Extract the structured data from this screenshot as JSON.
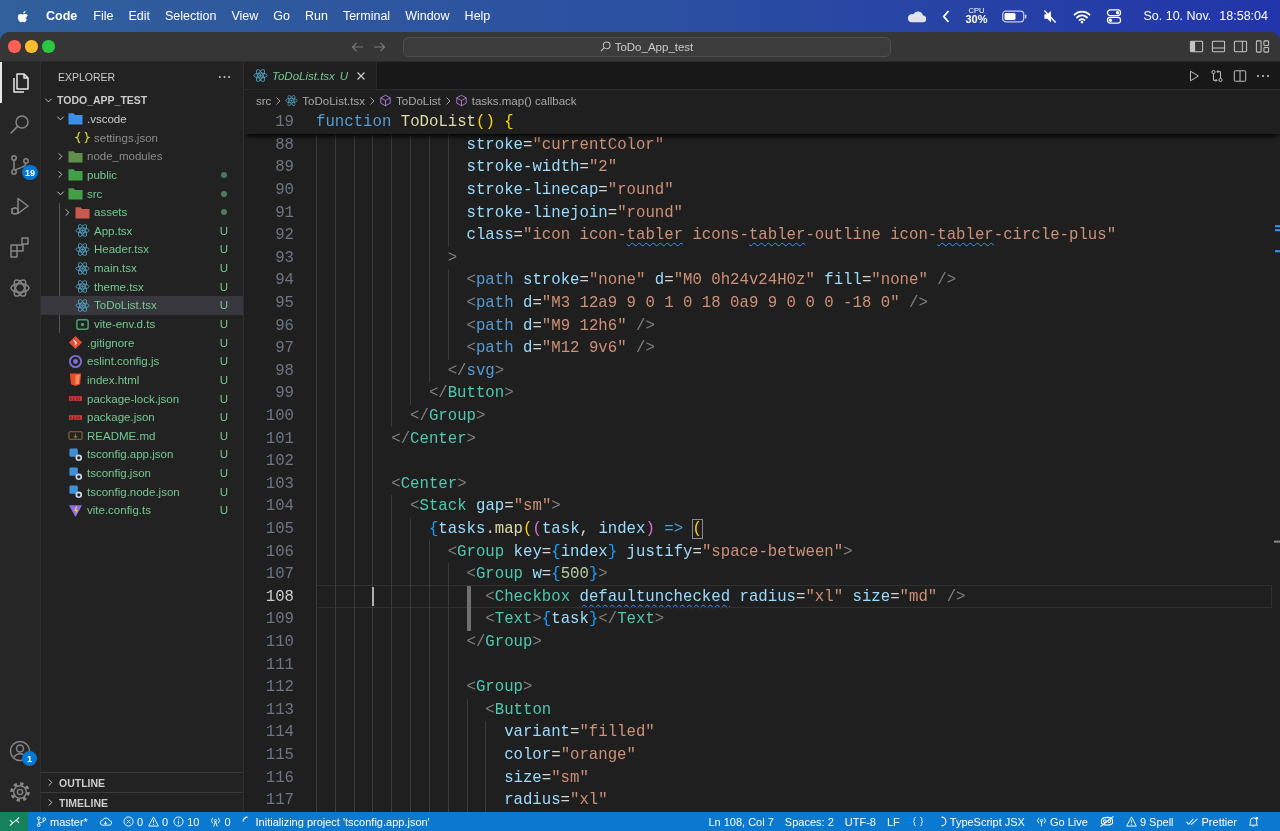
{
  "menu_bar": {
    "app_name": "Code",
    "menus": [
      "File",
      "Edit",
      "Selection",
      "View",
      "Go",
      "Run",
      "Terminal",
      "Window",
      "Help"
    ],
    "cpu_label": "CPU",
    "cpu_value": "30%",
    "date": "So. 10. Nov.",
    "time": "18:58:04"
  },
  "title_bar": {
    "command_center": "ToDo_App_test"
  },
  "activity_bar": {
    "items": [
      {
        "selected": true
      },
      {
        "selected": false
      },
      {
        "selected": false,
        "badge": "19"
      },
      {
        "selected": false
      },
      {
        "selected": false
      },
      {
        "selected": false
      }
    ],
    "accounts_badge": "1"
  },
  "explorer": {
    "title": "EXPLORER",
    "root": {
      "label": "TODO_APP_TEST",
      "expanded": true,
      "children": [
        {
          "label": ".vscode",
          "kind": "folder",
          "color": "#3b8eea",
          "expanded": true,
          "selected": false,
          "ignored": false,
          "changed": false,
          "children": [
            {
              "label": "settings.json",
              "kind": "json",
              "selected": false,
              "ignored": true,
              "changed": false
            }
          ]
        },
        {
          "label": "node_modules",
          "kind": "folder",
          "color": "#5f8f4a",
          "expanded": false,
          "selected": false,
          "ignored": true,
          "changed": false
        },
        {
          "label": "public",
          "kind": "folder",
          "color": "#43a047",
          "expanded": false,
          "selected": false,
          "ignored": false,
          "changed": true
        },
        {
          "label": "src",
          "kind": "folder",
          "color": "#43a047",
          "expanded": true,
          "selected": false,
          "ignored": false,
          "changed": true,
          "children": [
            {
              "label": "assets",
              "kind": "folder",
              "color": "#c65a4d",
              "expanded": false,
              "selected": false,
              "ignored": false,
              "changed": true
            },
            {
              "label": "App.tsx",
              "kind": "react",
              "decoration": "U",
              "selected": false,
              "ignored": false,
              "changed": false
            },
            {
              "label": "Header.tsx",
              "kind": "react",
              "decoration": "U",
              "selected": false,
              "ignored": false,
              "changed": false
            },
            {
              "label": "main.tsx",
              "kind": "react",
              "decoration": "U",
              "selected": false,
              "ignored": false,
              "changed": false
            },
            {
              "label": "theme.tsx",
              "kind": "react",
              "decoration": "U",
              "selected": false,
              "ignored": false,
              "changed": false
            },
            {
              "label": "ToDoList.tsx",
              "kind": "react",
              "decoration": "U",
              "selected": true,
              "ignored": false,
              "changed": false
            },
            {
              "label": "vite-env.d.ts",
              "kind": "ts",
              "decoration": "U",
              "selected": false,
              "ignored": false,
              "changed": false
            }
          ]
        },
        {
          "label": ".gitignore",
          "kind": "git",
          "decoration": "U",
          "selected": false,
          "ignored": false,
          "changed": false
        },
        {
          "label": "eslint.config.js",
          "kind": "eslint",
          "decoration": "U",
          "selected": false,
          "ignored": false,
          "changed": false
        },
        {
          "label": "index.html",
          "kind": "html",
          "decoration": "U",
          "selected": false,
          "ignored": false,
          "changed": false
        },
        {
          "label": "package-lock.json",
          "kind": "npm",
          "decoration": "U",
          "selected": false,
          "ignored": false,
          "changed": false
        },
        {
          "label": "package.json",
          "kind": "npm",
          "decoration": "U",
          "selected": false,
          "ignored": false,
          "changed": false
        },
        {
          "label": "README.md",
          "kind": "markdown",
          "decoration": "U",
          "selected": false,
          "ignored": false,
          "changed": false
        },
        {
          "label": "tsconfig.app.json",
          "kind": "tsconfig",
          "decoration": "U",
          "selected": false,
          "ignored": false,
          "changed": false
        },
        {
          "label": "tsconfig.json",
          "kind": "tsconfig",
          "decoration": "U",
          "selected": false,
          "ignored": false,
          "changed": false
        },
        {
          "label": "tsconfig.node.json",
          "kind": "tsconfig",
          "decoration": "U",
          "selected": false,
          "ignored": false,
          "changed": false
        },
        {
          "label": "vite.config.ts",
          "kind": "vite",
          "decoration": "U",
          "selected": false,
          "ignored": false,
          "changed": false
        }
      ]
    },
    "sections": [
      {
        "label": "OUTLINE",
        "expanded": false
      },
      {
        "label": "TIMELINE",
        "expanded": false
      }
    ]
  },
  "editor": {
    "tabs": [
      {
        "label": "ToDoList.tsx",
        "decoration": "U",
        "selected": true,
        "preview": true
      }
    ],
    "breadcrumbs": [
      {
        "label": "src",
        "kind": "folder"
      },
      {
        "label": "ToDoList.tsx",
        "kind": "react"
      },
      {
        "label": "ToDoList",
        "kind": "symbol"
      },
      {
        "label": "tasks.map() callback",
        "kind": "symbol"
      }
    ],
    "sticky_line": {
      "number": "19",
      "tokens": [
        {
          "kind": "keyword",
          "text": "function"
        },
        {
          "kind": "function",
          "text": " ToDoList"
        },
        {
          "kind": "bracket",
          "text": "()"
        },
        {
          "kind": "bracket",
          "text": " {"
        }
      ]
    },
    "lines": [
      {
        "number": "88",
        "current": false,
        "indent": [
          {
            "kind": "guide"
          },
          {
            "kind": "guide"
          },
          {
            "kind": "guide"
          },
          {
            "kind": "guide"
          },
          {
            "kind": "guide"
          },
          {
            "kind": "guide"
          },
          {
            "kind": "guide"
          },
          {
            "kind": "guide"
          }
        ],
        "tokens": [
          {
            "kind": "attr",
            "text": "stroke"
          },
          {
            "kind": "op",
            "text": "="
          },
          {
            "kind": "string",
            "text": "\"currentColor\""
          }
        ]
      },
      {
        "number": "89",
        "current": false,
        "indent": [
          {
            "kind": "guide"
          },
          {
            "kind": "guide"
          },
          {
            "kind": "guide"
          },
          {
            "kind": "guide"
          },
          {
            "kind": "guide"
          },
          {
            "kind": "guide"
          },
          {
            "kind": "guide"
          },
          {
            "kind": "guide"
          }
        ],
        "tokens": [
          {
            "kind": "attr",
            "text": "stroke-width"
          },
          {
            "kind": "op",
            "text": "="
          },
          {
            "kind": "string",
            "text": "\"2\""
          }
        ]
      },
      {
        "number": "90",
        "current": false,
        "indent": [
          {
            "kind": "guide"
          },
          {
            "kind": "guide"
          },
          {
            "kind": "guide"
          },
          {
            "kind": "guide"
          },
          {
            "kind": "guide"
          },
          {
            "kind": "guide"
          },
          {
            "kind": "guide"
          },
          {
            "kind": "guide"
          }
        ],
        "tokens": [
          {
            "kind": "attr",
            "text": "stroke-linecap"
          },
          {
            "kind": "op",
            "text": "="
          },
          {
            "kind": "string",
            "text": "\"round\""
          }
        ]
      },
      {
        "number": "91",
        "current": false,
        "indent": [
          {
            "kind": "guide"
          },
          {
            "kind": "guide"
          },
          {
            "kind": "guide"
          },
          {
            "kind": "guide"
          },
          {
            "kind": "guide"
          },
          {
            "kind": "guide"
          },
          {
            "kind": "guide"
          },
          {
            "kind": "guide"
          }
        ],
        "tokens": [
          {
            "kind": "attr",
            "text": "stroke-linejoin"
          },
          {
            "kind": "op",
            "text": "="
          },
          {
            "kind": "string",
            "text": "\"round\""
          }
        ]
      },
      {
        "number": "92",
        "current": false,
        "indent": [
          {
            "kind": "guide"
          },
          {
            "kind": "guide"
          },
          {
            "kind": "guide"
          },
          {
            "kind": "guide"
          },
          {
            "kind": "guide"
          },
          {
            "kind": "guide"
          },
          {
            "kind": "guide"
          },
          {
            "kind": "guide"
          }
        ],
        "tokens": [
          {
            "kind": "attr",
            "text": "class"
          },
          {
            "kind": "op",
            "text": "="
          },
          {
            "kind": "string",
            "text": "\"icon icon-"
          },
          {
            "kind": "flaggedstring",
            "text": "tabler"
          },
          {
            "kind": "string",
            "text": " icons-"
          },
          {
            "kind": "flaggedstring",
            "text": "tabler"
          },
          {
            "kind": "string",
            "text": "-outline icon-"
          },
          {
            "kind": "flaggedstring",
            "text": "tabler"
          },
          {
            "kind": "string",
            "text": "-circle-plus\""
          }
        ]
      },
      {
        "number": "93",
        "current": false,
        "indent": [
          {
            "kind": "guide"
          },
          {
            "kind": "guide"
          },
          {
            "kind": "guide"
          },
          {
            "kind": "guide"
          },
          {
            "kind": "guide"
          },
          {
            "kind": "guide"
          },
          {
            "kind": "guide"
          }
        ],
        "tokens": [
          {
            "kind": "punct",
            "text": ">"
          }
        ]
      },
      {
        "number": "94",
        "current": false,
        "indent": [
          {
            "kind": "guide"
          },
          {
            "kind": "guide"
          },
          {
            "kind": "guide"
          },
          {
            "kind": "guide"
          },
          {
            "kind": "guide"
          },
          {
            "kind": "guide"
          },
          {
            "kind": "guide"
          },
          {
            "kind": "guide"
          }
        ],
        "tokens": [
          {
            "kind": "punct",
            "text": "<"
          },
          {
            "kind": "htmltag",
            "text": "path"
          },
          {
            "kind": "attr",
            "text": " stroke"
          },
          {
            "kind": "op",
            "text": "="
          },
          {
            "kind": "string",
            "text": "\"none\""
          },
          {
            "kind": "attr",
            "text": " d"
          },
          {
            "kind": "op",
            "text": "="
          },
          {
            "kind": "string",
            "text": "\"M0 0h24v24H0z\""
          },
          {
            "kind": "attr",
            "text": " fill"
          },
          {
            "kind": "op",
            "text": "="
          },
          {
            "kind": "string",
            "text": "\"none\""
          },
          {
            "kind": "punct",
            "text": " />"
          }
        ]
      },
      {
        "number": "95",
        "current": false,
        "indent": [
          {
            "kind": "guide"
          },
          {
            "kind": "guide"
          },
          {
            "kind": "guide"
          },
          {
            "kind": "guide"
          },
          {
            "kind": "guide"
          },
          {
            "kind": "guide"
          },
          {
            "kind": "guide"
          },
          {
            "kind": "guide"
          }
        ],
        "tokens": [
          {
            "kind": "punct",
            "text": "<"
          },
          {
            "kind": "htmltag",
            "text": "path"
          },
          {
            "kind": "attr",
            "text": " d"
          },
          {
            "kind": "op",
            "text": "="
          },
          {
            "kind": "string",
            "text": "\"M3 12a9 9 0 1 0 18 0a9 9 0 0 0 -18 0\""
          },
          {
            "kind": "punct",
            "text": " />"
          }
        ]
      },
      {
        "number": "96",
        "current": false,
        "indent": [
          {
            "kind": "guide"
          },
          {
            "kind": "guide"
          },
          {
            "kind": "guide"
          },
          {
            "kind": "guide"
          },
          {
            "kind": "guide"
          },
          {
            "kind": "guide"
          },
          {
            "kind": "guide"
          },
          {
            "kind": "guide"
          }
        ],
        "tokens": [
          {
            "kind": "punct",
            "text": "<"
          },
          {
            "kind": "htmltag",
            "text": "path"
          },
          {
            "kind": "attr",
            "text": " d"
          },
          {
            "kind": "op",
            "text": "="
          },
          {
            "kind": "string",
            "text": "\"M9 12h6\""
          },
          {
            "kind": "punct",
            "text": " />"
          }
        ]
      },
      {
        "number": "97",
        "current": false,
        "indent": [
          {
            "kind": "guide"
          },
          {
            "kind": "guide"
          },
          {
            "kind": "guide"
          },
          {
            "kind": "guide"
          },
          {
            "kind": "guide"
          },
          {
            "kind": "guide"
          },
          {
            "kind": "guide"
          },
          {
            "kind": "guide"
          }
        ],
        "tokens": [
          {
            "kind": "punct",
            "text": "<"
          },
          {
            "kind": "htmltag",
            "text": "path"
          },
          {
            "kind": "attr",
            "text": " d"
          },
          {
            "kind": "op",
            "text": "="
          },
          {
            "kind": "string",
            "text": "\"M12 9v6\""
          },
          {
            "kind": "punct",
            "text": " />"
          }
        ]
      },
      {
        "number": "98",
        "current": false,
        "indent": [
          {
            "kind": "guide"
          },
          {
            "kind": "guide"
          },
          {
            "kind": "guide"
          },
          {
            "kind": "guide"
          },
          {
            "kind": "guide"
          },
          {
            "kind": "guide"
          },
          {
            "kind": "guide"
          }
        ],
        "tokens": [
          {
            "kind": "punct",
            "text": "</"
          },
          {
            "kind": "htmltag",
            "text": "svg"
          },
          {
            "kind": "punct",
            "text": ">"
          }
        ]
      },
      {
        "number": "99",
        "current": false,
        "indent": [
          {
            "kind": "guide"
          },
          {
            "kind": "guide"
          },
          {
            "kind": "guide"
          },
          {
            "kind": "guide"
          },
          {
            "kind": "guide"
          },
          {
            "kind": "guide"
          }
        ],
        "tokens": [
          {
            "kind": "punct",
            "text": "</"
          },
          {
            "kind": "tag",
            "text": "Button"
          },
          {
            "kind": "punct",
            "text": ">"
          }
        ]
      },
      {
        "number": "100",
        "current": false,
        "indent": [
          {
            "kind": "guide"
          },
          {
            "kind": "guide"
          },
          {
            "kind": "guide"
          },
          {
            "kind": "guide"
          },
          {
            "kind": "guide"
          }
        ],
        "tokens": [
          {
            "kind": "punct",
            "text": "</"
          },
          {
            "kind": "tag",
            "text": "Group"
          },
          {
            "kind": "punct",
            "text": ">"
          }
        ]
      },
      {
        "number": "101",
        "current": false,
        "indent": [
          {
            "kind": "guide"
          },
          {
            "kind": "guide"
          },
          {
            "kind": "guide"
          },
          {
            "kind": "guide"
          }
        ],
        "tokens": [
          {
            "kind": "punct",
            "text": "</"
          },
          {
            "kind": "tag",
            "text": "Center"
          },
          {
            "kind": "punct",
            "text": ">"
          }
        ]
      },
      {
        "number": "102",
        "current": false,
        "indent": [
          {
            "kind": "guide"
          },
          {
            "kind": "guide"
          },
          {
            "kind": "guide"
          },
          {
            "kind": "guide"
          }
        ]
      },
      {
        "number": "103",
        "current": false,
        "indent": [
          {
            "kind": "guide"
          },
          {
            "kind": "guide"
          },
          {
            "kind": "guide"
          },
          {
            "kind": "guide"
          }
        ],
        "tokens": [
          {
            "kind": "punct",
            "text": "<"
          },
          {
            "kind": "tag",
            "text": "Center"
          },
          {
            "kind": "punct",
            "text": ">"
          }
        ]
      },
      {
        "number": "104",
        "current": false,
        "indent": [
          {
            "kind": "guide"
          },
          {
            "kind": "guide"
          },
          {
            "kind": "guide"
          },
          {
            "kind": "guide"
          },
          {
            "kind": "guide"
          }
        ],
        "tokens": [
          {
            "kind": "punct",
            "text": "<"
          },
          {
            "kind": "tag",
            "text": "Stack"
          },
          {
            "kind": "attr",
            "text": " gap"
          },
          {
            "kind": "op",
            "text": "="
          },
          {
            "kind": "string",
            "text": "\"sm\""
          },
          {
            "kind": "punct",
            "text": ">"
          }
        ]
      },
      {
        "number": "105",
        "current": false,
        "indent": [
          {
            "kind": "guide"
          },
          {
            "kind": "guide"
          },
          {
            "kind": "guide"
          },
          {
            "kind": "guide"
          },
          {
            "kind": "guide"
          },
          {
            "kind": "guide"
          }
        ],
        "tokens": [
          {
            "kind": "bracketblue",
            "text": "{"
          },
          {
            "kind": "variable",
            "text": "tasks"
          },
          {
            "kind": "op",
            "text": "."
          },
          {
            "kind": "function",
            "text": "map"
          },
          {
            "kind": "bracket",
            "text": "("
          },
          {
            "kind": "bracketpink",
            "text": "("
          },
          {
            "kind": "variable",
            "text": "task"
          },
          {
            "kind": "op",
            "text": ", "
          },
          {
            "kind": "variable",
            "text": "index"
          },
          {
            "kind": "bracketpink",
            "text": ")"
          },
          {
            "kind": "keyword",
            "text": " => "
          },
          {
            "kind": "bracketmatch",
            "text": "("
          }
        ]
      },
      {
        "number": "106",
        "current": false,
        "indent": [
          {
            "kind": "guide"
          },
          {
            "kind": "guide"
          },
          {
            "kind": "guide"
          },
          {
            "kind": "guide"
          },
          {
            "kind": "guide"
          },
          {
            "kind": "guide"
          },
          {
            "kind": "guide"
          }
        ],
        "tokens": [
          {
            "kind": "punct",
            "text": "<"
          },
          {
            "kind": "tag",
            "text": "Group"
          },
          {
            "kind": "attr",
            "text": " key"
          },
          {
            "kind": "op",
            "text": "="
          },
          {
            "kind": "bracketblue",
            "text": "{"
          },
          {
            "kind": "variable",
            "text": "index"
          },
          {
            "kind": "bracketblue",
            "text": "}"
          },
          {
            "kind": "attr",
            "text": " justify"
          },
          {
            "kind": "op",
            "text": "="
          },
          {
            "kind": "string",
            "text": "\"space-between\""
          },
          {
            "kind": "punct",
            "text": ">"
          }
        ]
      },
      {
        "number": "107",
        "current": false,
        "indent": [
          {
            "kind": "guide"
          },
          {
            "kind": "guide"
          },
          {
            "kind": "guide"
          },
          {
            "kind": "guide"
          },
          {
            "kind": "guide"
          },
          {
            "kind": "guide"
          },
          {
            "kind": "guide"
          },
          {
            "kind": "guide"
          }
        ],
        "tokens": [
          {
            "kind": "punct",
            "text": "<"
          },
          {
            "kind": "tag",
            "text": "Group"
          },
          {
            "kind": "attr",
            "text": " w"
          },
          {
            "kind": "op",
            "text": "="
          },
          {
            "kind": "bracketblue",
            "text": "{"
          },
          {
            "kind": "number",
            "text": "500"
          },
          {
            "kind": "bracketblue",
            "text": "}"
          },
          {
            "kind": "punct",
            "text": ">"
          }
        ]
      },
      {
        "number": "108",
        "current": true,
        "indent": [
          {
            "kind": "guide"
          },
          {
            "kind": "guide"
          },
          {
            "kind": "guide"
          },
          {
            "kind": "cursor"
          },
          {
            "kind": "guide"
          },
          {
            "kind": "guide"
          },
          {
            "kind": "guide"
          },
          {
            "kind": "guide"
          },
          {
            "kind": "guide"
          },
          {
            "kind": "activeguide"
          }
        ],
        "tokens": [
          {
            "kind": "punct",
            "text": "<"
          },
          {
            "kind": "tag",
            "text": "Checkbox "
          },
          {
            "kind": "flaggedattr",
            "text": "defaultunchecked"
          },
          {
            "kind": "attr",
            "text": " radius"
          },
          {
            "kind": "op",
            "text": "="
          },
          {
            "kind": "string",
            "text": "\"xl\""
          },
          {
            "kind": "attr",
            "text": " size"
          },
          {
            "kind": "op",
            "text": "="
          },
          {
            "kind": "string",
            "text": "\"md\""
          },
          {
            "kind": "punct",
            "text": " />"
          }
        ]
      },
      {
        "number": "109",
        "current": false,
        "indent": [
          {
            "kind": "guide"
          },
          {
            "kind": "guide"
          },
          {
            "kind": "guide"
          },
          {
            "kind": "guide"
          },
          {
            "kind": "guide"
          },
          {
            "kind": "guide"
          },
          {
            "kind": "guide"
          },
          {
            "kind": "guide"
          },
          {
            "kind": "activeguide"
          }
        ],
        "tokens": [
          {
            "kind": "punct",
            "text": "<"
          },
          {
            "kind": "tag",
            "text": "Text"
          },
          {
            "kind": "punct",
            "text": ">"
          },
          {
            "kind": "bracketblue",
            "text": "{"
          },
          {
            "kind": "variable",
            "text": "task"
          },
          {
            "kind": "bracketblue",
            "text": "}"
          },
          {
            "kind": "punct",
            "text": "</"
          },
          {
            "kind": "tag",
            "text": "Text"
          },
          {
            "kind": "punct",
            "text": ">"
          }
        ]
      },
      {
        "number": "110",
        "current": false,
        "indent": [
          {
            "kind": "guide"
          },
          {
            "kind": "guide"
          },
          {
            "kind": "guide"
          },
          {
            "kind": "guide"
          },
          {
            "kind": "guide"
          },
          {
            "kind": "guide"
          },
          {
            "kind": "guide"
          },
          {
            "kind": "guide"
          }
        ],
        "tokens": [
          {
            "kind": "punct",
            "text": "</"
          },
          {
            "kind": "tag",
            "text": "Group"
          },
          {
            "kind": "punct",
            "text": ">"
          }
        ]
      },
      {
        "number": "111",
        "current": false,
        "indent": [
          {
            "kind": "guide"
          },
          {
            "kind": "guide"
          },
          {
            "kind": "guide"
          },
          {
            "kind": "guide"
          },
          {
            "kind": "guide"
          },
          {
            "kind": "guide"
          },
          {
            "kind": "guide"
          },
          {
            "kind": "guide"
          }
        ]
      },
      {
        "number": "112",
        "current": false,
        "indent": [
          {
            "kind": "guide"
          },
          {
            "kind": "guide"
          },
          {
            "kind": "guide"
          },
          {
            "kind": "guide"
          },
          {
            "kind": "guide"
          },
          {
            "kind": "guide"
          },
          {
            "kind": "guide"
          },
          {
            "kind": "guide"
          }
        ],
        "tokens": [
          {
            "kind": "punct",
            "text": "<"
          },
          {
            "kind": "tag",
            "text": "Group"
          },
          {
            "kind": "punct",
            "text": ">"
          }
        ]
      },
      {
        "number": "113",
        "current": false,
        "indent": [
          {
            "kind": "guide"
          },
          {
            "kind": "guide"
          },
          {
            "kind": "guide"
          },
          {
            "kind": "guide"
          },
          {
            "kind": "guide"
          },
          {
            "kind": "guide"
          },
          {
            "kind": "guide"
          },
          {
            "kind": "guide"
          },
          {
            "kind": "guide"
          }
        ],
        "tokens": [
          {
            "kind": "punct",
            "text": "<"
          },
          {
            "kind": "tag",
            "text": "Button"
          }
        ]
      },
      {
        "number": "114",
        "current": false,
        "indent": [
          {
            "kind": "guide"
          },
          {
            "kind": "guide"
          },
          {
            "kind": "guide"
          },
          {
            "kind": "guide"
          },
          {
            "kind": "guide"
          },
          {
            "kind": "guide"
          },
          {
            "kind": "guide"
          },
          {
            "kind": "guide"
          },
          {
            "kind": "guide"
          },
          {
            "kind": "guide"
          }
        ],
        "tokens": [
          {
            "kind": "attr",
            "text": "variant"
          },
          {
            "kind": "op",
            "text": "="
          },
          {
            "kind": "string",
            "text": "\"filled\""
          }
        ]
      },
      {
        "number": "115",
        "current": false,
        "indent": [
          {
            "kind": "guide"
          },
          {
            "kind": "guide"
          },
          {
            "kind": "guide"
          },
          {
            "kind": "guide"
          },
          {
            "kind": "guide"
          },
          {
            "kind": "guide"
          },
          {
            "kind": "guide"
          },
          {
            "kind": "guide"
          },
          {
            "kind": "guide"
          },
          {
            "kind": "guide"
          }
        ],
        "tokens": [
          {
            "kind": "attr",
            "text": "color"
          },
          {
            "kind": "op",
            "text": "="
          },
          {
            "kind": "string",
            "text": "\"orange\""
          }
        ]
      },
      {
        "number": "116",
        "current": false,
        "indent": [
          {
            "kind": "guide"
          },
          {
            "kind": "guide"
          },
          {
            "kind": "guide"
          },
          {
            "kind": "guide"
          },
          {
            "kind": "guide"
          },
          {
            "kind": "guide"
          },
          {
            "kind": "guide"
          },
          {
            "kind": "guide"
          },
          {
            "kind": "guide"
          },
          {
            "kind": "guide"
          }
        ],
        "tokens": [
          {
            "kind": "attr",
            "text": "size"
          },
          {
            "kind": "op",
            "text": "="
          },
          {
            "kind": "string",
            "text": "\"sm\""
          }
        ]
      },
      {
        "number": "117",
        "current": false,
        "indent": [
          {
            "kind": "guide"
          },
          {
            "kind": "guide"
          },
          {
            "kind": "guide"
          },
          {
            "kind": "guide"
          },
          {
            "kind": "guide"
          },
          {
            "kind": "guide"
          },
          {
            "kind": "guide"
          },
          {
            "kind": "guide"
          },
          {
            "kind": "guide"
          },
          {
            "kind": "guide"
          }
        ],
        "tokens": [
          {
            "kind": "attr",
            "text": "radius"
          },
          {
            "kind": "op",
            "text": "="
          },
          {
            "kind": "string",
            "text": "\"xl\""
          }
        ]
      }
    ]
  },
  "status_bar": {
    "branch": "master*",
    "errors": "0",
    "warnings": "0",
    "infos": "10",
    "ports": "0",
    "progress": "Initializing project 'tsconfig.app.json'",
    "cursor_position": "Ln 108, Col 7",
    "indentation": "Spaces: 2",
    "encoding": "UTF-8",
    "line_ending": "LF",
    "language": "TypeScript JSX",
    "live_server": "Go Live",
    "spell": "9 Spell",
    "formatter": "Prettier"
  }
}
